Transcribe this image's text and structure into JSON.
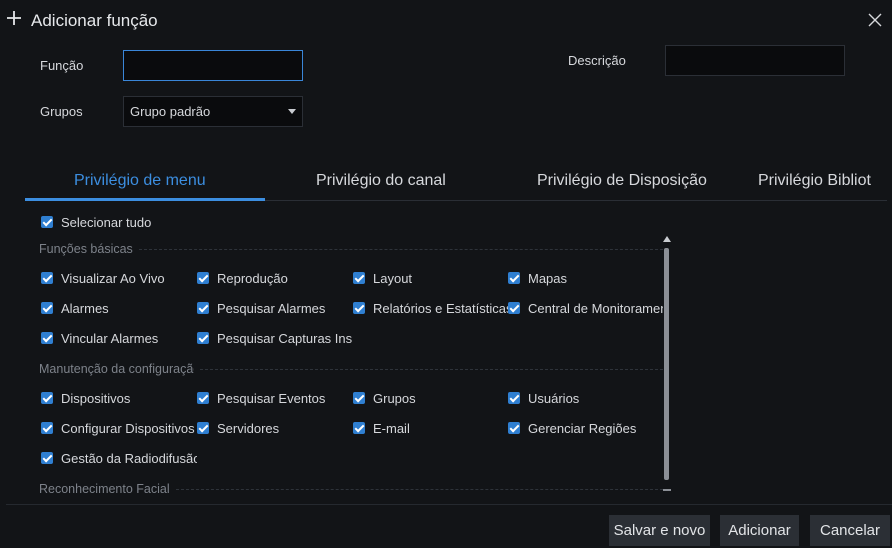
{
  "dialog": {
    "title": "Adicionar função",
    "title_icon": "plus-icon",
    "close_icon": "close-icon"
  },
  "form": {
    "funcao_label": "Função",
    "funcao_value": "",
    "descricao_label": "Descrição",
    "descricao_value": "",
    "grupos_label": "Grupos",
    "grupos_value": "Grupo padrão"
  },
  "tabs": [
    {
      "label": "Privilégio de menu",
      "active": true
    },
    {
      "label": "Privilégio do canal",
      "active": false
    },
    {
      "label": "Privilégio de Disposição",
      "active": false
    },
    {
      "label": "Privilégio Bibliot",
      "active": false
    }
  ],
  "select_all": {
    "label": "Selecionar tudo",
    "checked": true
  },
  "sections": [
    {
      "title": "Funções básicas",
      "items": [
        {
          "label": "Visualizar Ao Vivo",
          "checked": true
        },
        {
          "label": "Reprodução",
          "checked": true
        },
        {
          "label": "Layout",
          "checked": true
        },
        {
          "label": "Mapas",
          "checked": true
        },
        {
          "label": "Alarmes",
          "checked": true
        },
        {
          "label": "Pesquisar Alarmes",
          "checked": true
        },
        {
          "label": "Relatórios e Estatísticas",
          "checked": true
        },
        {
          "label": "Central de Monitoramento",
          "checked": true
        },
        {
          "label": "Vincular Alarmes",
          "checked": true
        },
        {
          "label": "Pesquisar Capturas Instantâneas",
          "checked": true
        }
      ]
    },
    {
      "title": "Manutenção da configuração",
      "items": [
        {
          "label": "Dispositivos",
          "checked": true
        },
        {
          "label": "Pesquisar Eventos",
          "checked": true
        },
        {
          "label": "Grupos",
          "checked": true
        },
        {
          "label": "Usuários",
          "checked": true
        },
        {
          "label": "Configurar Dispositivos",
          "checked": true
        },
        {
          "label": "Servidores",
          "checked": true
        },
        {
          "label": "E-mail",
          "checked": true
        },
        {
          "label": "Gerenciar Regiões",
          "checked": true
        },
        {
          "label": "Gestão da Radiodifusão",
          "checked": true
        }
      ]
    },
    {
      "title": "Reconhecimento Facial",
      "items": []
    }
  ],
  "footer": {
    "save_new_label": "Salvar e novo",
    "add_label": "Adicionar",
    "cancel_label": "Cancelar"
  },
  "colors": {
    "background": "#121417",
    "accent": "#3c8ee0",
    "checkbox": "#2f7fd1",
    "button": "#2b2f35"
  }
}
